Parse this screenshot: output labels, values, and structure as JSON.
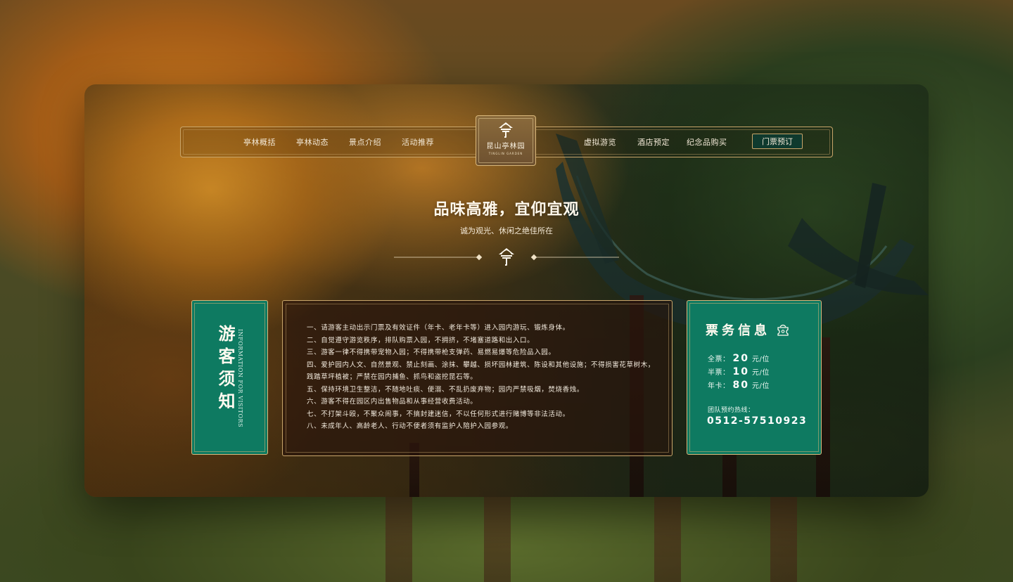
{
  "nav": {
    "left_items": [
      "亭林概括",
      "亭林动态",
      "景点介绍",
      "活动推荐"
    ],
    "right_items": [
      "虚拟游览",
      "酒店预定",
      "纪念品购买"
    ],
    "book_button": "门票预订"
  },
  "logo": {
    "text": "昆山亭林园",
    "sub": "TINGLIN GARDEN"
  },
  "hero": {
    "title": "品味高雅，宜仰宜观",
    "subtitle": "诚为观光、休闲之绝佳所在"
  },
  "notice": {
    "title": "游客须知",
    "subtitle_en": "INFORMATION FOR VISITORS",
    "rules": [
      "一、请游客主动出示门票及有效证件（年卡、老年卡等）进入园内游玩、锻炼身体。",
      "二、自觉遵守游览秩序，排队购票入园，不拥挤，不堵塞道路和出入口。",
      "三、游客一律不得携带宠物入园；不得携带枪支弹药、易燃易爆等危险品入园。",
      "四、爱护园内人文、自然景观、禁止刻画、涂抹、攀越、损坏园林建筑、陈设和其他设施；不得损害花草树木，践踏草坪植被；严禁在园内捕鱼、抓鸟和盗挖昆石等。",
      "五、保持环境卫生整洁，不随地吐痰、便溺、不乱扔废弃物；园内严禁吸烟，焚烧香烛。",
      "六、游客不得在园区内出售物品和从事经营收费活动。",
      "七、不打架斗殴，不聚众闹事，不搞封建迷信，不以任何形式进行赌博等非法活动。",
      "八、未成年人、高龄老人、行动不便者须有监护人陪护入园参观。"
    ]
  },
  "ticket": {
    "title": "票务信息",
    "prices": [
      {
        "label": "全票：",
        "value": "20",
        "unit": "元/位"
      },
      {
        "label": "半票：",
        "value": "10",
        "unit": "元/位"
      },
      {
        "label": "年卡：",
        "value": "80",
        "unit": "元/位"
      }
    ],
    "hotline_label": "团队预约热线：",
    "hotline_number": "0512-57510923"
  },
  "colors": {
    "accent_green": "#0e7a61",
    "gold_border": "#c8a56a",
    "book_button_bg": "#0f3a2e"
  }
}
